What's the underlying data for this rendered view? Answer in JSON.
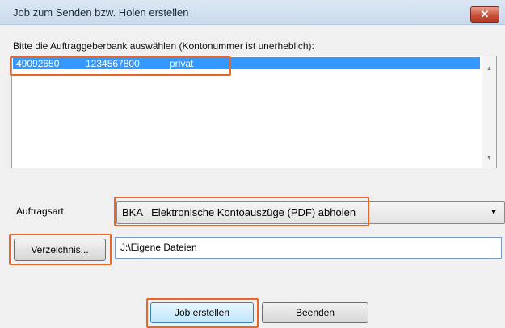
{
  "window": {
    "title": "Job zum Senden bzw. Holen erstellen",
    "close_symbol": "✕"
  },
  "instruction": "Bitte die Auftraggeberbank auswählen (Kontonummer ist unerheblich):",
  "account_list": {
    "items": [
      {
        "bank_code": "49092650",
        "account_number": "1234567800",
        "name": "privat",
        "selected": true
      }
    ]
  },
  "order_type": {
    "label": "Auftragsart",
    "selected": "BKA   Elektronische Kontoauszüge (PDF) abholen"
  },
  "directory": {
    "button_label": "Verzeichnis...",
    "path": "J:\\Eigene Dateien"
  },
  "buttons": {
    "create_job": "Job erstellen",
    "quit": "Beenden"
  },
  "colors": {
    "selection": "#3399ff",
    "highlight": "#e8662a"
  }
}
